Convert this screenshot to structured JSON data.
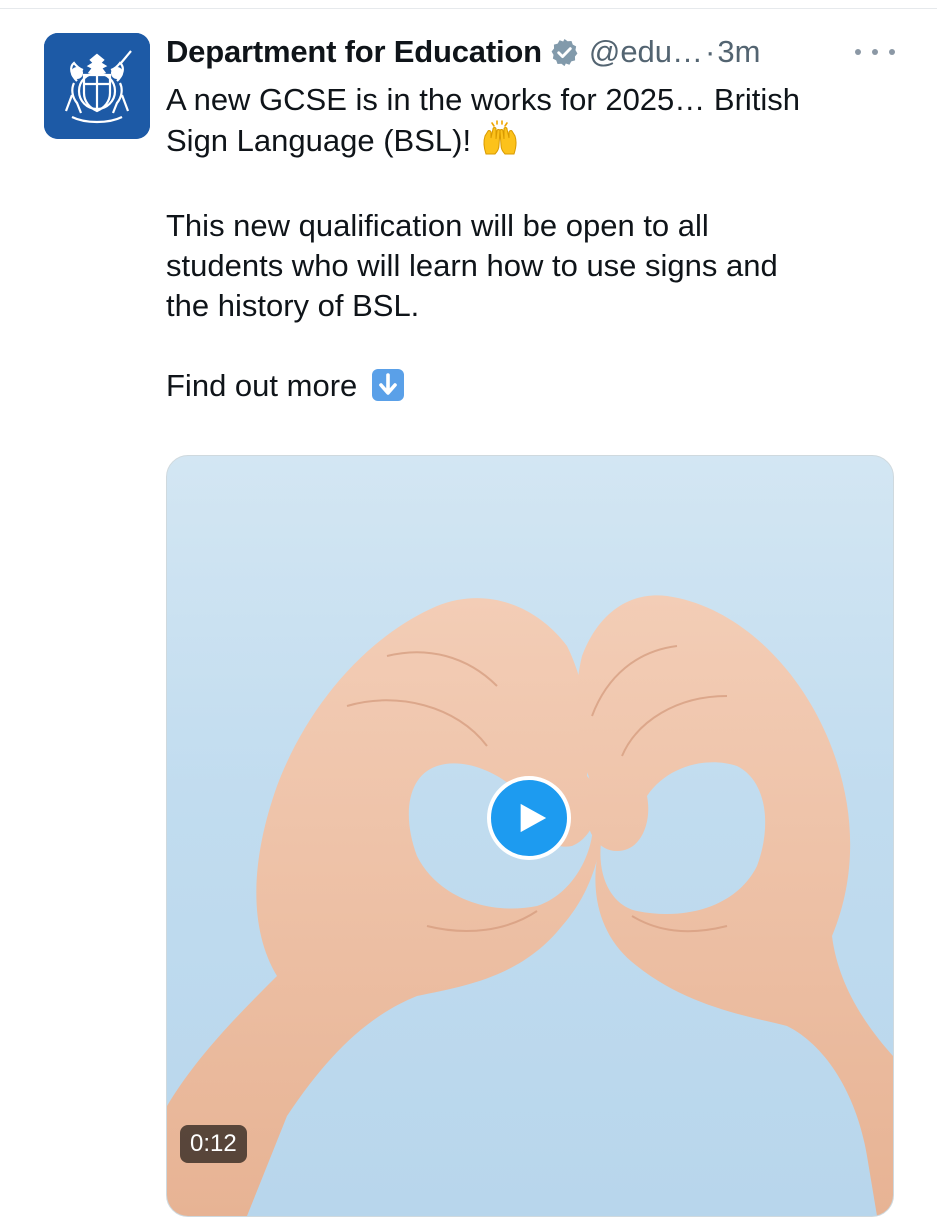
{
  "tweet": {
    "author_name": "Department for Education",
    "handle": "@edu…",
    "separator": "·",
    "timestamp": "3m",
    "verified_icon": "verified-badge-icon",
    "text_lines": [
      "A new GCSE is in the works for 2025… British",
      "Sign Language (BSL)!",
      "This new qualification will be open to all",
      "students who will learn how to use signs and",
      "the history of BSL.",
      "Find out more"
    ],
    "emojis": {
      "raising_hands": "raising-hands-emoji",
      "down_arrow": "down-arrow-emoji"
    }
  },
  "media": {
    "type": "video",
    "duration": "0:12",
    "play_icon": "play-icon"
  },
  "colors": {
    "avatar_bg": "#1d5aa6",
    "play_button": "#1d9bf0",
    "secondary_text": "#536471"
  }
}
